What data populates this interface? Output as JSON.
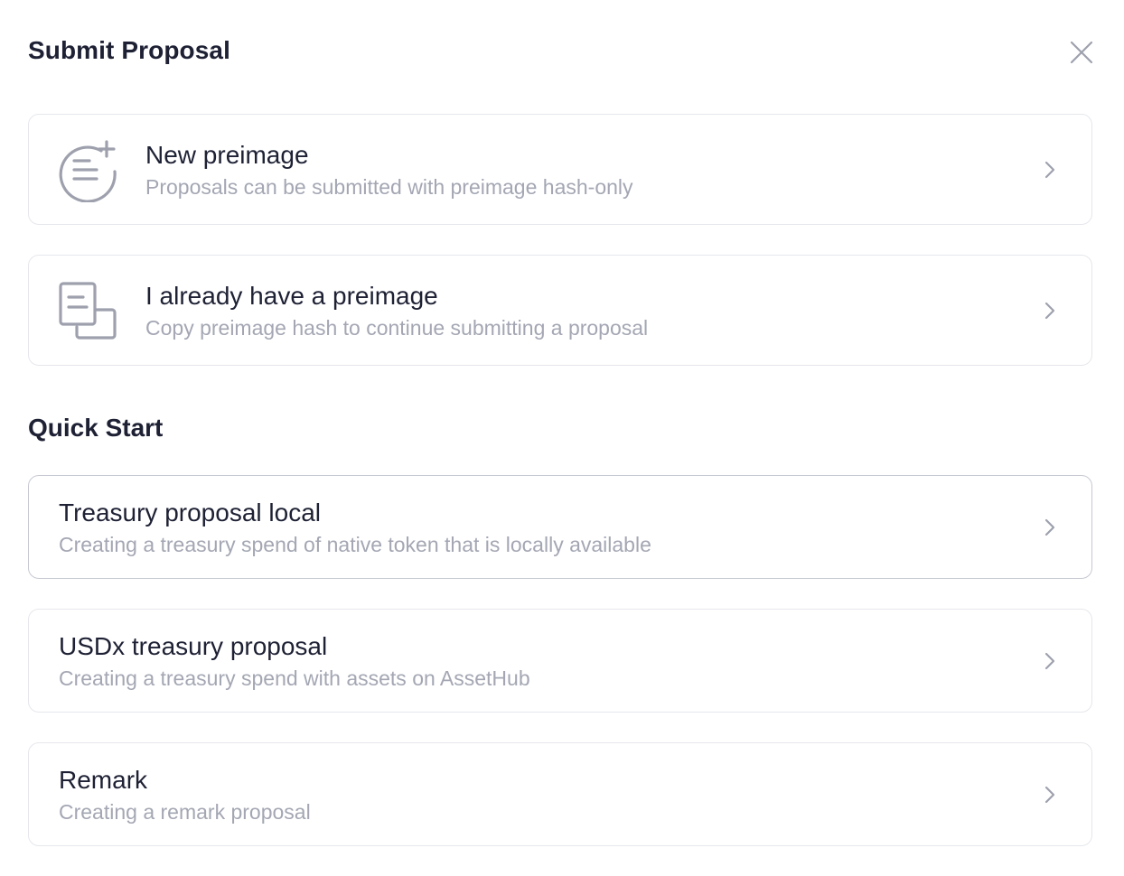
{
  "header": {
    "title": "Submit Proposal",
    "close_icon": "close-icon"
  },
  "preimage_options": [
    {
      "title": "New preimage",
      "description": "Proposals can be submitted with preimage hash-only",
      "icon": "new-preimage-icon"
    },
    {
      "title": "I already have a preimage",
      "description": "Copy preimage hash to continue submitting a proposal",
      "icon": "copy-preimage-icon"
    }
  ],
  "quick_start": {
    "title": "Quick Start",
    "items": [
      {
        "title": "Treasury proposal local",
        "description": "Creating a treasury spend of native token that is locally available"
      },
      {
        "title": "USDx treasury proposal",
        "description": "Creating a treasury spend with assets on AssetHub"
      },
      {
        "title": "Remark",
        "description": "Creating a remark proposal"
      }
    ]
  },
  "colors": {
    "text_primary": "#1e2134",
    "text_secondary": "#a4a7b3",
    "border": "#e6e7ec",
    "icon": "#9ea1ad"
  }
}
